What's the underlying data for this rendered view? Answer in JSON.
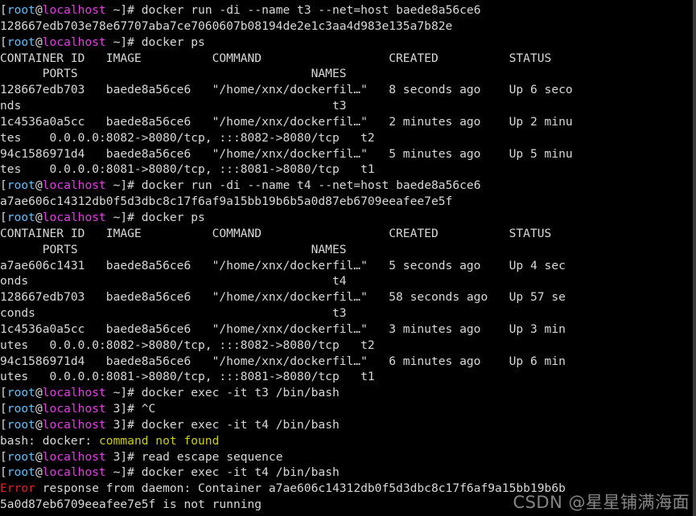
{
  "terminal": {
    "title": "root@localhost terminal",
    "columns": 102,
    "rows": 32,
    "background": "#000000",
    "foreground": "#d8d8d8",
    "colors": {
      "user": "#5fbff9",
      "host": "#e23de2",
      "error_red": "#e02020",
      "warn_yellow": "#cdcd00",
      "default": "#d8d8d8"
    },
    "prompt": {
      "user": "root",
      "at": "@",
      "host": "localhost",
      "cwd_home": "~",
      "cwd_container": "3",
      "sigil": "]# ",
      "open_bracket": "["
    }
  },
  "watermark": {
    "text": "CSDN @星星铺满海面"
  },
  "lines": [
    {
      "type": "prompt",
      "cwd": "~",
      "command": "docker run -di --name t3 --net=host baede8a56ce6"
    },
    {
      "type": "output",
      "text": "128667edb703e78e67707aba7ce7060607b08194de2e1c3aa4d983e135a7b82e"
    },
    {
      "type": "prompt",
      "cwd": "~",
      "command": "docker ps"
    },
    {
      "type": "output",
      "text": "CONTAINER ID   IMAGE          COMMAND                  CREATED          STATUS"
    },
    {
      "type": "output",
      "text": "      PORTS                                 NAMES"
    },
    {
      "type": "output",
      "text": "128667edb703   baede8a56ce6   \"/home/xnx/dockerfil…\"   8 seconds ago    Up 6 seco"
    },
    {
      "type": "output",
      "text": "nds                                            t3"
    },
    {
      "type": "output",
      "text": "1c4536a0a5cc   baede8a56ce6   \"/home/xnx/dockerfil…\"   2 minutes ago    Up 2 minu"
    },
    {
      "type": "output",
      "text": "tes    0.0.0.0:8082->8080/tcp, :::8082->8080/tcp   t2"
    },
    {
      "type": "output",
      "text": "94c1586971d4   baede8a56ce6   \"/home/xnx/dockerfil…\"   5 minutes ago    Up 5 minu"
    },
    {
      "type": "output",
      "text": "tes    0.0.0.0:8081->8080/tcp, :::8081->8080/tcp   t1"
    },
    {
      "type": "prompt",
      "cwd": "~",
      "command": "docker run -di --name t4 --net=host baede8a56ce6"
    },
    {
      "type": "output",
      "text": "a7ae606c14312db0f5d3dbc8c17f6af9a15bb19b6b5a0d87eb6709eeafee7e5f"
    },
    {
      "type": "prompt",
      "cwd": "~",
      "command": "docker ps"
    },
    {
      "type": "output",
      "text": "CONTAINER ID   IMAGE          COMMAND                  CREATED          STATUS"
    },
    {
      "type": "output",
      "text": "      PORTS                                 NAMES"
    },
    {
      "type": "output",
      "text": "a7ae606c1431   baede8a56ce6   \"/home/xnx/dockerfil…\"   5 seconds ago    Up 4 sec"
    },
    {
      "type": "output",
      "text": "onds                                           t4"
    },
    {
      "type": "output",
      "text": "128667edb703   baede8a56ce6   \"/home/xnx/dockerfil…\"   58 seconds ago   Up 57 se"
    },
    {
      "type": "output",
      "text": "conds                                          t3"
    },
    {
      "type": "output",
      "text": "1c4536a0a5cc   baede8a56ce6   \"/home/xnx/dockerfil…\"   3 minutes ago    Up 3 min"
    },
    {
      "type": "output",
      "text": "utes   0.0.0.0:8082->8080/tcp, :::8082->8080/tcp   t2"
    },
    {
      "type": "output",
      "text": "94c1586971d4   baede8a56ce6   \"/home/xnx/dockerfil…\"   6 minutes ago    Up 6 min"
    },
    {
      "type": "output",
      "text": "utes   0.0.0.0:8081->8080/tcp, :::8081->8080/tcp   t1"
    },
    {
      "type": "prompt",
      "cwd": "~",
      "command": "docker exec -it t3 /bin/bash"
    },
    {
      "type": "prompt",
      "cwd": "3",
      "command": "^C"
    },
    {
      "type": "prompt",
      "cwd": "3",
      "command": "docker exec -it t4 /bin/bash"
    },
    {
      "type": "error_yellow",
      "prefix": "bash: docker: ",
      "highlight": "command not found"
    },
    {
      "type": "prompt",
      "cwd": "3",
      "command": "read escape sequence"
    },
    {
      "type": "prompt",
      "cwd": "~",
      "command": "docker exec -it t4 /bin/bash"
    },
    {
      "type": "error_red",
      "highlight": "Error",
      "rest": " response from daemon: Container a7ae606c14312db0f5d3dbc8c17f6af9a15bb19b6b"
    },
    {
      "type": "output",
      "text": "5a0d87eb6709eeafee7e5f is not running"
    }
  ]
}
